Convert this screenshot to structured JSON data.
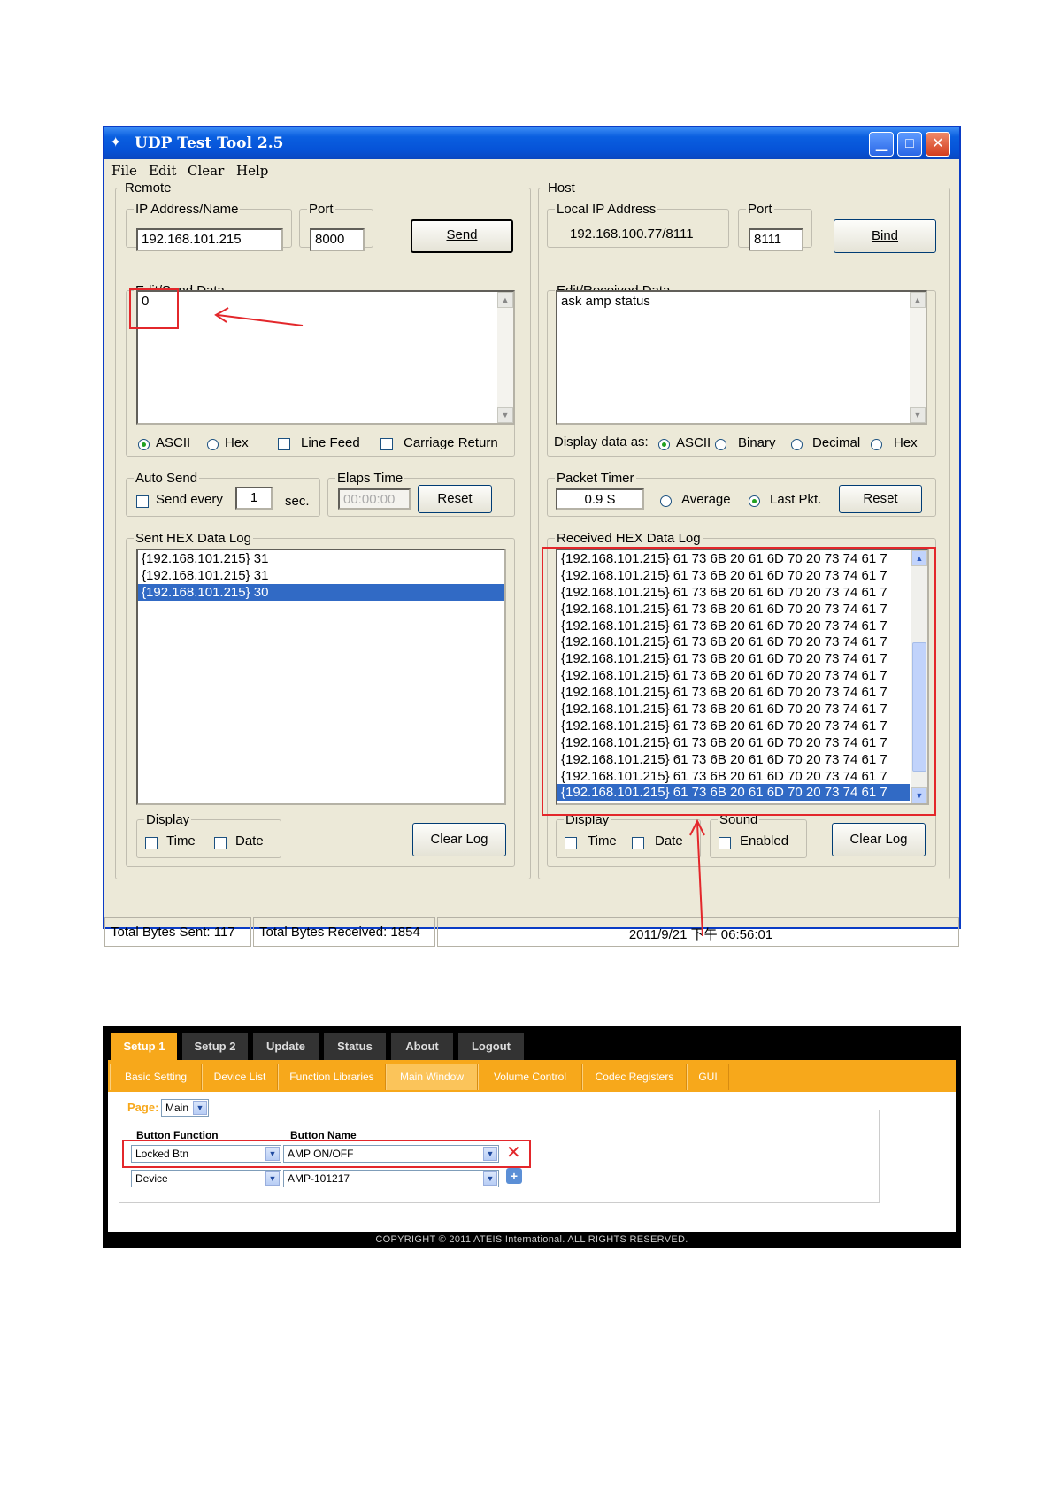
{
  "window": {
    "title": "UDP Test Tool 2.5",
    "menu": [
      "File",
      "Edit",
      "Clear",
      "Help"
    ],
    "remote": {
      "legend": "Remote",
      "ip_legend": "IP Address/Name",
      "ip_value": "192.168.101.215",
      "port_legend": "Port",
      "port_value": "8000",
      "send_label": "Send",
      "edit_legend": "Edit/Send Data",
      "send_data": "0",
      "encoding": {
        "ascii": "ASCII",
        "hex": "Hex",
        "line_feed": "Line Feed",
        "carriage_return": "Carriage Return",
        "selected": "ASCII"
      },
      "auto_send": {
        "legend": "Auto Send",
        "send_every": "Send every",
        "interval": "1",
        "unit": "sec."
      },
      "elaps": {
        "legend": "Elaps Time",
        "value": "00:00:00",
        "reset_label": "Reset"
      },
      "sent_log": {
        "legend": "Sent HEX Data Log",
        "lines": [
          "{192.168.101.215} 31",
          "{192.168.101.215} 31",
          "{192.168.101.215} 30"
        ],
        "selected_index": 2
      },
      "display": {
        "legend": "Display",
        "time": "Time",
        "date": "Date"
      },
      "clear_log_label": "Clear Log"
    },
    "host": {
      "legend": "Host",
      "local_ip_legend": "Local IP Address",
      "local_ip_value": "192.168.100.77/8111",
      "port_legend": "Port",
      "port_value": "8111",
      "bind_label": "Bind",
      "edit_legend": "Edit/Received Data",
      "received_data": "ask amp status",
      "display_as": {
        "label": "Display data as:",
        "ascii": "ASCII",
        "binary": "Binary",
        "decimal": "Decimal",
        "hex": "Hex",
        "selected": "ASCII"
      },
      "packet_timer": {
        "legend": "Packet Timer",
        "value": "0.9 S",
        "average": "Average",
        "last_pkt": "Last Pkt.",
        "selected": "Last Pkt.",
        "reset_label": "Reset"
      },
      "received_log": {
        "legend": "Received HEX Data Log",
        "lines": [
          "{192.168.101.215} 61 73 6B 20 61 6D 70 20 73 74 61 7",
          "{192.168.101.215} 61 73 6B 20 61 6D 70 20 73 74 61 7",
          "{192.168.101.215} 61 73 6B 20 61 6D 70 20 73 74 61 7",
          "{192.168.101.215} 61 73 6B 20 61 6D 70 20 73 74 61 7",
          "{192.168.101.215} 61 73 6B 20 61 6D 70 20 73 74 61 7",
          "{192.168.101.215} 61 73 6B 20 61 6D 70 20 73 74 61 7",
          "{192.168.101.215} 61 73 6B 20 61 6D 70 20 73 74 61 7",
          "{192.168.101.215} 61 73 6B 20 61 6D 70 20 73 74 61 7",
          "{192.168.101.215} 61 73 6B 20 61 6D 70 20 73 74 61 7",
          "{192.168.101.215} 61 73 6B 20 61 6D 70 20 73 74 61 7",
          "{192.168.101.215} 61 73 6B 20 61 6D 70 20 73 74 61 7",
          "{192.168.101.215} 61 73 6B 20 61 6D 70 20 73 74 61 7",
          "{192.168.101.215} 61 73 6B 20 61 6D 70 20 73 74 61 7",
          "{192.168.101.215} 61 73 6B 20 61 6D 70 20 73 74 61 7",
          "{192.168.101.215} 61 73 6B 20 61 6D 70 20 73 74 61 7"
        ],
        "selected_index": 14
      },
      "display": {
        "legend": "Display",
        "time": "Time",
        "date": "Date"
      },
      "sound": {
        "legend": "Sound",
        "enabled": "Enabled"
      },
      "clear_log_label": "Clear Log"
    },
    "status": {
      "sent": "Total Bytes Sent: 117",
      "received": "Total Bytes Received: 1854",
      "datetime": "2011/9/21 下午 06:56:01"
    }
  },
  "web": {
    "main_tabs": [
      "Setup 1",
      "Setup 2",
      "Update",
      "Status",
      "About",
      "Logout"
    ],
    "active_main_tab": "Setup 1",
    "sub_tabs": [
      "Basic Setting",
      "Device List",
      "Function Libraries",
      "Main Window",
      "Volume Control",
      "Codec Registers",
      "GUI"
    ],
    "active_sub_tab": "Main Window",
    "page_label": "Page:",
    "page_value": "Main",
    "col_function": "Button Function",
    "col_name": "Button Name",
    "rows": [
      {
        "function": "Locked Btn",
        "name": "AMP ON/OFF"
      },
      {
        "function": "Device",
        "name": "AMP-101217"
      }
    ],
    "copyright": "COPYRIGHT © 2011 ATEIS International. ALL RIGHTS RESERVED."
  },
  "colors": {
    "accent_orange": "#f7a81b",
    "title_blue": "#0653d8",
    "selection_blue": "#316ac5",
    "annotation_red": "#e3272b"
  }
}
